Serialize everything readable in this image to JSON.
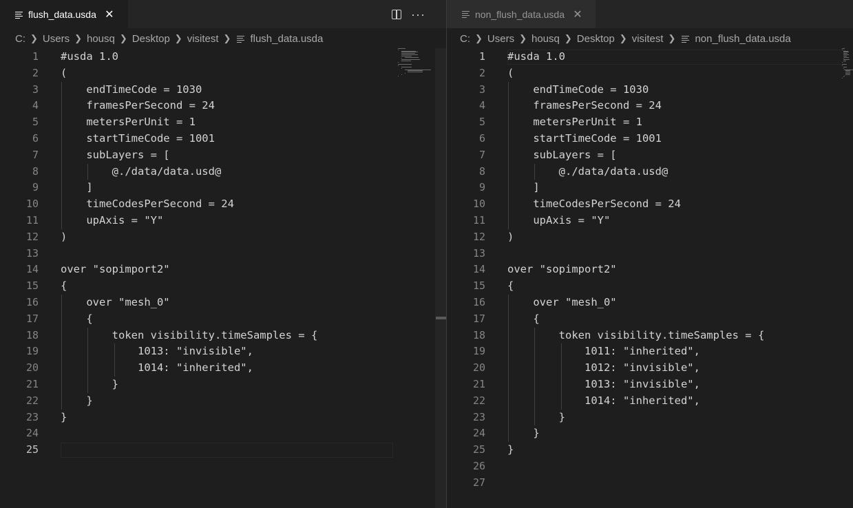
{
  "left": {
    "tab": {
      "label": "flush_data.usda",
      "close": "✕"
    },
    "breadcrumb": {
      "drive": "C:",
      "p1": "Users",
      "p2": "housq",
      "p3": "Desktop",
      "p4": "visitest",
      "file": "flush_data.usda"
    },
    "current_line": 25,
    "lines": [
      "#usda 1.0",
      "(",
      "    endTimeCode = 1030",
      "    framesPerSecond = 24",
      "    metersPerUnit = 1",
      "    startTimeCode = 1001",
      "    subLayers = [",
      "        @./data/data.usd@",
      "    ]",
      "    timeCodesPerSecond = 24",
      "    upAxis = \"Y\"",
      ")",
      "",
      "over \"sopimport2\"",
      "{",
      "    over \"mesh_0\"",
      "    {",
      "        token visibility.timeSamples = {",
      "            1013: \"invisible\",",
      "            1014: \"inherited\",",
      "        }",
      "    }",
      "}",
      "",
      ""
    ]
  },
  "right": {
    "tab": {
      "label": "non_flush_data.usda",
      "close": "✕"
    },
    "breadcrumb": {
      "drive": "C:",
      "p1": "Users",
      "p2": "housq",
      "p3": "Desktop",
      "p4": "visitest",
      "file": "non_flush_data.usda"
    },
    "current_line": 1,
    "lines": [
      "#usda 1.0",
      "(",
      "    endTimeCode = 1030",
      "    framesPerSecond = 24",
      "    metersPerUnit = 1",
      "    startTimeCode = 1001",
      "    subLayers = [",
      "        @./data/data.usd@",
      "    ]",
      "    timeCodesPerSecond = 24",
      "    upAxis = \"Y\"",
      ")",
      "",
      "over \"sopimport2\"",
      "{",
      "    over \"mesh_0\"",
      "    {",
      "        token visibility.timeSamples = {",
      "            1011: \"inherited\",",
      "            1012: \"invisible\",",
      "            1013: \"invisible\",",
      "            1014: \"inherited\",",
      "        }",
      "    }",
      "}",
      "",
      ""
    ]
  },
  "icons": {
    "split": "split-editor-icon",
    "more": "more-actions-icon",
    "more_glyph": "···",
    "chevron": "›"
  }
}
